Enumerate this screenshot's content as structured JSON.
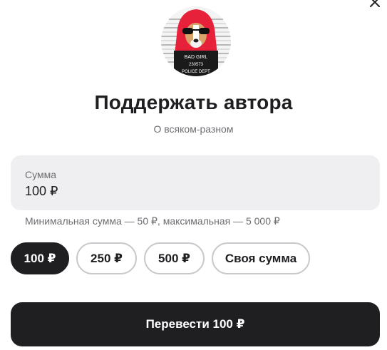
{
  "dialog": {
    "close_icon": "close-icon",
    "avatar": {
      "sign_line1": "BAD GIRL",
      "sign_line2": "230573",
      "sign_line3": "POLICE DEPT"
    },
    "title": "Поддержать автора",
    "subtitle": "О всяком-разном"
  },
  "amount": {
    "label": "Сумма",
    "value": "100 ₽",
    "hint": "Минимальная сумма — 50 ₽, максимальная — 5 000 ₽"
  },
  "presets": [
    {
      "label": "100 ₽",
      "selected": true
    },
    {
      "label": "250 ₽",
      "selected": false
    },
    {
      "label": "500 ₽",
      "selected": false
    },
    {
      "label": "Своя сумма",
      "selected": false
    }
  ],
  "submit": {
    "label": "Перевести 100 ₽"
  },
  "colors": {
    "accent": "#1f1f22",
    "field_bg": "#efeff1",
    "muted_text": "#6e6e73",
    "chip_border": "#c9c9cd",
    "avatar_hood": "#e8213a"
  }
}
